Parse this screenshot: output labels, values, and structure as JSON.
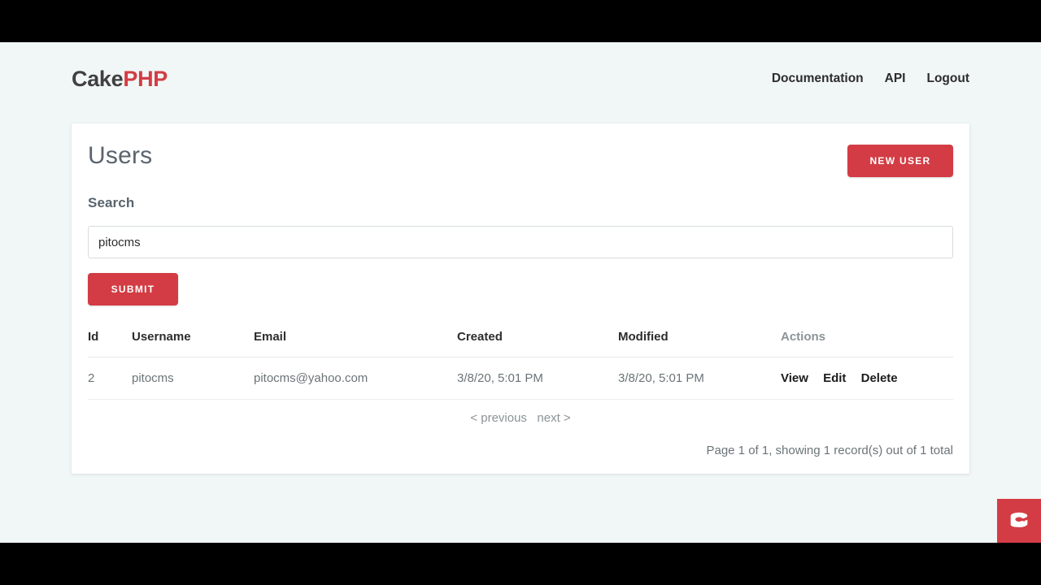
{
  "nav": {
    "brand_first": "Cake",
    "brand_second": "PHP",
    "links": [
      {
        "label": "Documentation"
      },
      {
        "label": "API"
      },
      {
        "label": "Logout"
      }
    ]
  },
  "card": {
    "title": "Users",
    "new_button": "NEW USER",
    "search_label": "Search",
    "search_value": "pitocms",
    "search_placeholder": "",
    "submit_button": "SUBMIT"
  },
  "table": {
    "headers": [
      "Id",
      "Username",
      "Email",
      "Created",
      "Modified",
      "Actions"
    ],
    "rows": [
      {
        "id": "2",
        "username": "pitocms",
        "email": "pitocms@yahoo.com",
        "created": "3/8/20, 5:01 PM",
        "modified": "3/8/20, 5:01 PM",
        "actions": [
          "View",
          "Edit",
          "Delete"
        ]
      }
    ]
  },
  "paginator": {
    "previous": "< previous",
    "next": "next >",
    "counter": "Page 1 of 1, showing 1 record(s) out of 1 total"
  },
  "badge": {
    "icon": "cakephp-logo-icon"
  },
  "colors": {
    "accent_red": "#d33c44",
    "page_background": "#f1f6f6",
    "card_background": "#ffffff",
    "heading_gray": "#5a646e",
    "body_gray": "#6b7478",
    "muted_gray": "#8b9397"
  }
}
